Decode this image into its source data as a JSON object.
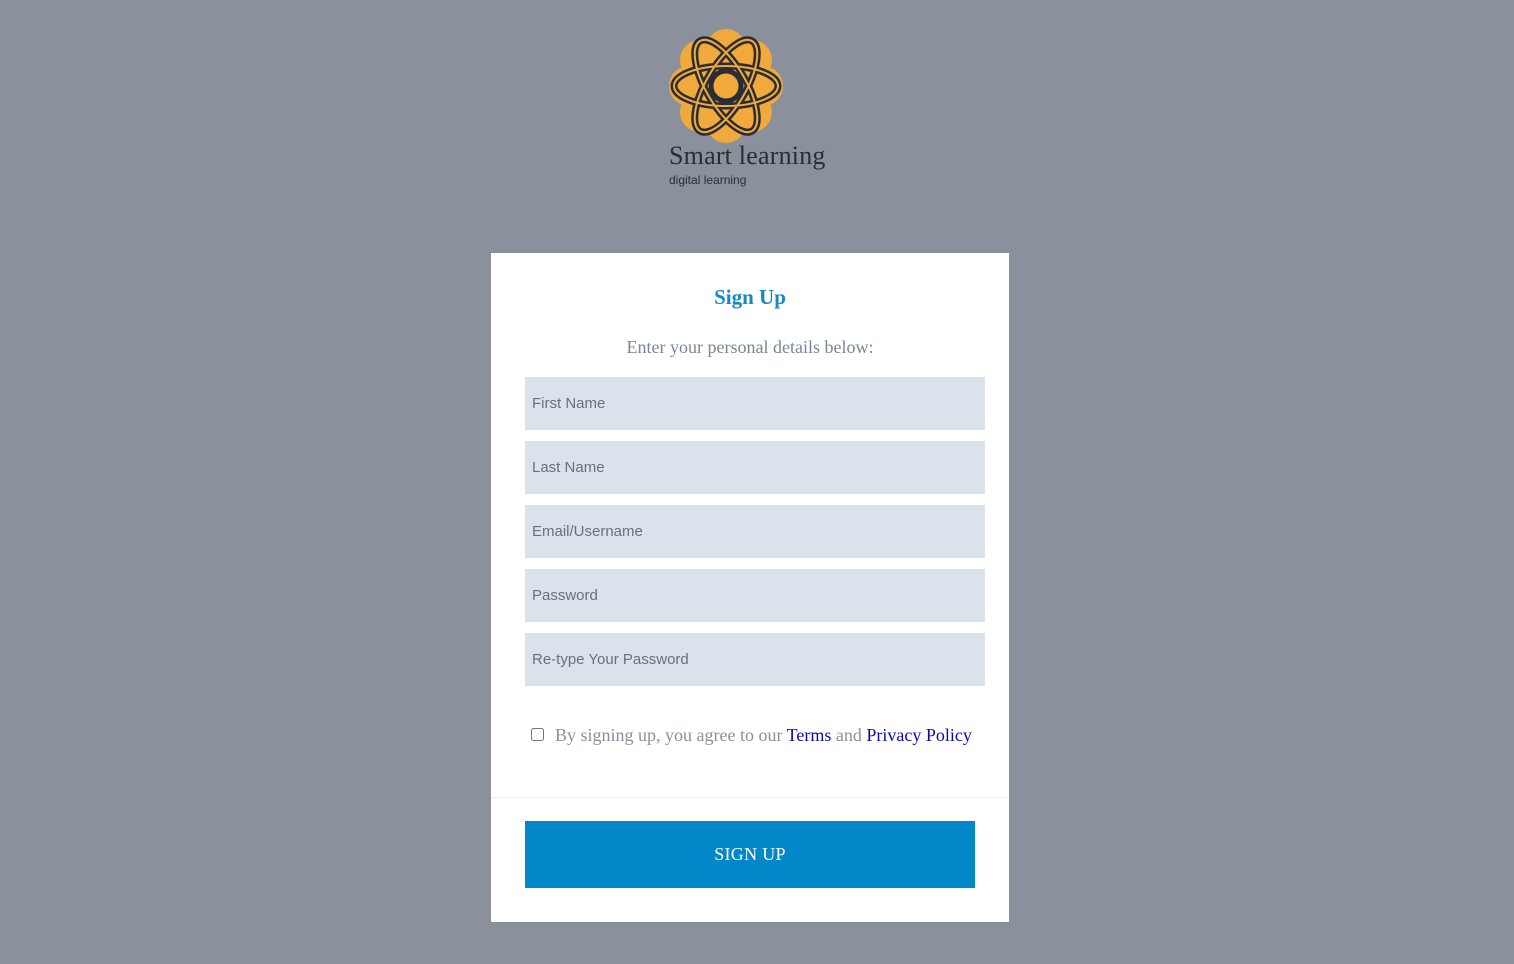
{
  "logo": {
    "title": "Smart learning",
    "subtitle": "digital learning"
  },
  "colors": {
    "page_background": "#8a919c",
    "logo_orange": "#f0a93a",
    "logo_dark": "#2a2d33",
    "title_blue": "#1588c8",
    "field_background": "#dce2eb",
    "button_blue": "#0288c9",
    "link_blue": "#0b0ba8"
  },
  "form": {
    "title": "Sign Up",
    "subtitle": "Enter your personal details below:",
    "fields": [
      {
        "name": "first-name-input",
        "placeholder": "First Name",
        "value": ""
      },
      {
        "name": "last-name-input",
        "placeholder": "Last Name",
        "value": ""
      },
      {
        "name": "email-username-input",
        "placeholder": "Email/Username",
        "value": ""
      },
      {
        "name": "password-input",
        "placeholder": "Password",
        "value": ""
      },
      {
        "name": "retype-password-input",
        "placeholder": "Re-type Your Password",
        "value": ""
      }
    ],
    "agreement": {
      "checked": false,
      "prefix": "By signing up, you agree to our",
      "terms_link": "Terms",
      "conjunction": "and",
      "privacy_link": "Privacy Policy"
    },
    "submit_label": "SIGN UP"
  }
}
